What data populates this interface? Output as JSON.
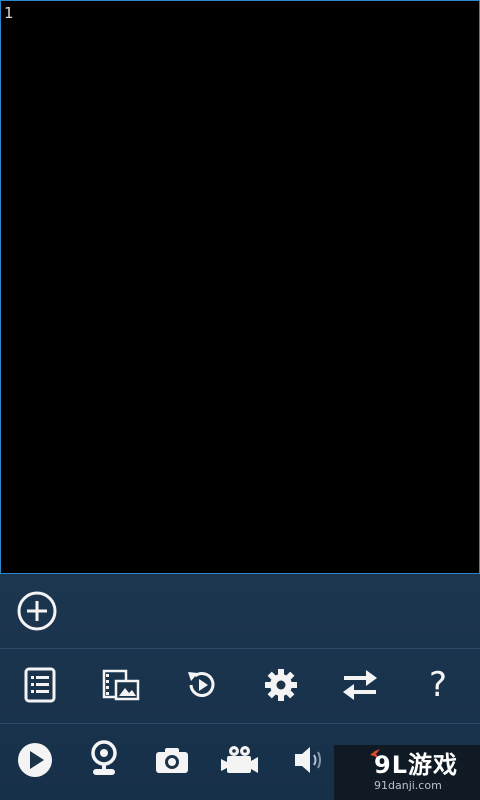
{
  "video": {
    "channel_label": "1"
  },
  "toolbar": {
    "add_icon": "plus-circle-icon",
    "row2": [
      {
        "name": "list-button",
        "icon": "list-icon"
      },
      {
        "name": "gallery-button",
        "icon": "film-image-icon"
      },
      {
        "name": "playback-button",
        "icon": "replay-icon"
      },
      {
        "name": "settings-button",
        "icon": "gear-icon"
      },
      {
        "name": "switch-button",
        "icon": "swap-arrows-icon"
      },
      {
        "name": "help-button",
        "icon": "question-icon",
        "glyph": "?"
      }
    ],
    "row3": [
      {
        "name": "play-button",
        "icon": "play-icon"
      },
      {
        "name": "webcam-button",
        "icon": "webcam-icon"
      },
      {
        "name": "snapshot-button",
        "icon": "camera-icon"
      },
      {
        "name": "record-button",
        "icon": "video-camera-icon"
      },
      {
        "name": "audio-button",
        "icon": "speaker-icon"
      }
    ]
  },
  "watermark": {
    "logo": "9L游戏",
    "domain": "91danji.com"
  },
  "colors": {
    "accent_border": "#2f86c9",
    "panel_bg": "#1b3247",
    "icon": "#f4f4f4"
  }
}
